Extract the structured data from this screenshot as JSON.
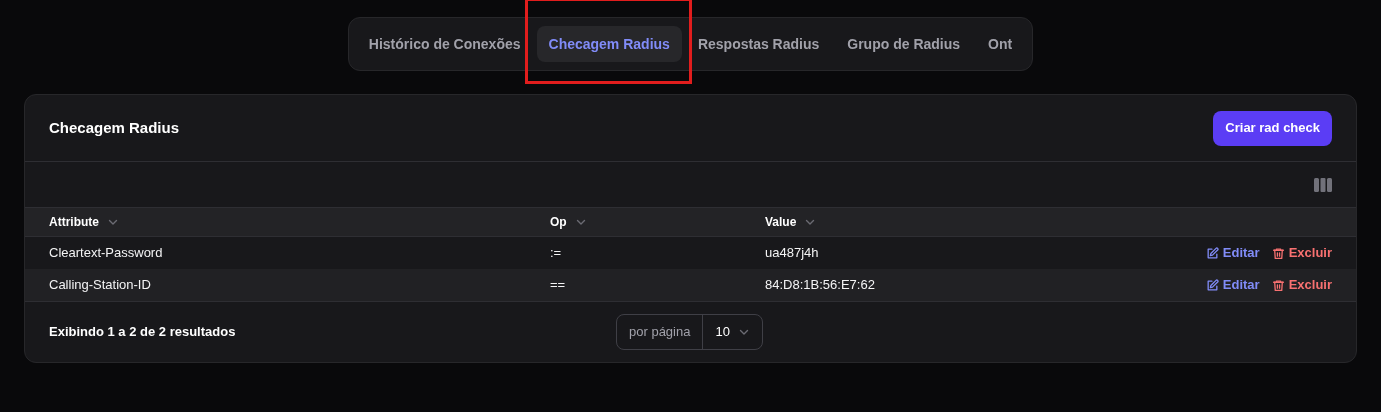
{
  "tabs": [
    {
      "label": "Histórico de Conexões",
      "selected": false
    },
    {
      "label": "Checagem Radius",
      "selected": true
    },
    {
      "label": "Respostas Radius",
      "selected": false
    },
    {
      "label": "Grupo de Radius",
      "selected": false
    },
    {
      "label": "Ont",
      "selected": false
    }
  ],
  "card": {
    "title": "Checagem Radius",
    "create_button": "Criar rad check"
  },
  "table": {
    "columns": [
      "Attribute",
      "Op",
      "Value"
    ],
    "rows": [
      {
        "cells": [
          "Cleartext-Password",
          ":=",
          "ua487j4h"
        ],
        "edit": "Editar",
        "delete": "Excluir"
      },
      {
        "cells": [
          "Calling-Station-ID",
          "==",
          "84:D8:1B:56:E7:62"
        ],
        "edit": "Editar",
        "delete": "Excluir"
      }
    ]
  },
  "footer": {
    "summary": "Exibindo 1 a 2 de 2 resultados",
    "per_page_label": "por página",
    "per_page_value": "10"
  }
}
